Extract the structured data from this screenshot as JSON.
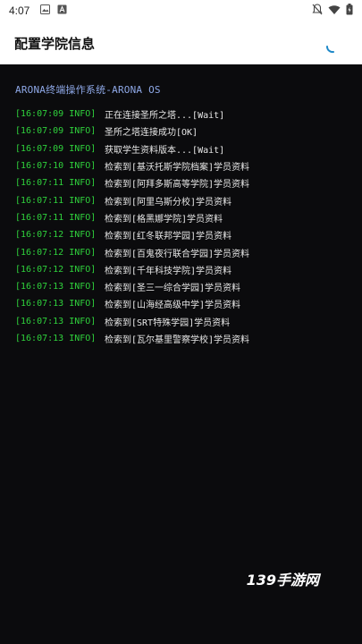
{
  "status_bar": {
    "time": "4:07",
    "left_icons": [
      "image-icon",
      "font-icon"
    ],
    "right_icons": [
      "bell-muted-icon",
      "wifi-icon",
      "battery-icon"
    ]
  },
  "app_header": {
    "title": "配置学院信息",
    "spinner": "loading-spinner-icon"
  },
  "terminal": {
    "header": "ARONA终端操作系统-ARONA OS",
    "lines": [
      {
        "ts": "[16:07:09 INFO]",
        "msg": "正在连接圣所之塔...[Wait]"
      },
      {
        "ts": "[16:07:09 INFO]",
        "msg": "圣所之塔连接成功[OK]"
      },
      {
        "ts": "[16:07:09 INFO]",
        "msg": "获取学生资料版本...[Wait]"
      },
      {
        "ts": "[16:07:10 INFO]",
        "msg": "检索到[基沃托斯学院档案]学员资料"
      },
      {
        "ts": "[16:07:11 INFO]",
        "msg": "检索到[阿拜多斯高等学院]学员资料"
      },
      {
        "ts": "[16:07:11 INFO]",
        "msg": "检索到[阿里乌斯分校]学员资料"
      },
      {
        "ts": "[16:07:11 INFO]",
        "msg": "检索到[格黑娜学院]学员资料"
      },
      {
        "ts": "[16:07:12 INFO]",
        "msg": "检索到[红冬联邦学园]学员资料"
      },
      {
        "ts": "[16:07:12 INFO]",
        "msg": "检索到[百鬼夜行联合学园]学员资料"
      },
      {
        "ts": "[16:07:12 INFO]",
        "msg": "检索到[千年科技学院]学员资料"
      },
      {
        "ts": "[16:07:13 INFO]",
        "msg": "检索到[圣三一综合学园]学员资料"
      },
      {
        "ts": "[16:07:13 INFO]",
        "msg": "检索到[山海经高级中学]学员资料"
      },
      {
        "ts": "[16:07:13 INFO]",
        "msg": "检索到[SRT特殊学园]学员资料"
      },
      {
        "ts": "[16:07:13 INFO]",
        "msg": "检索到[瓦尔基里警察学校]学员资料"
      }
    ]
  },
  "watermark": "139手游网",
  "colors": {
    "background": "#0b0b0d",
    "timestamp": "#2fd13c",
    "header_text": "#8fa9e8",
    "message_text": "#e8e8e8",
    "spinner": "#1e88c8"
  }
}
